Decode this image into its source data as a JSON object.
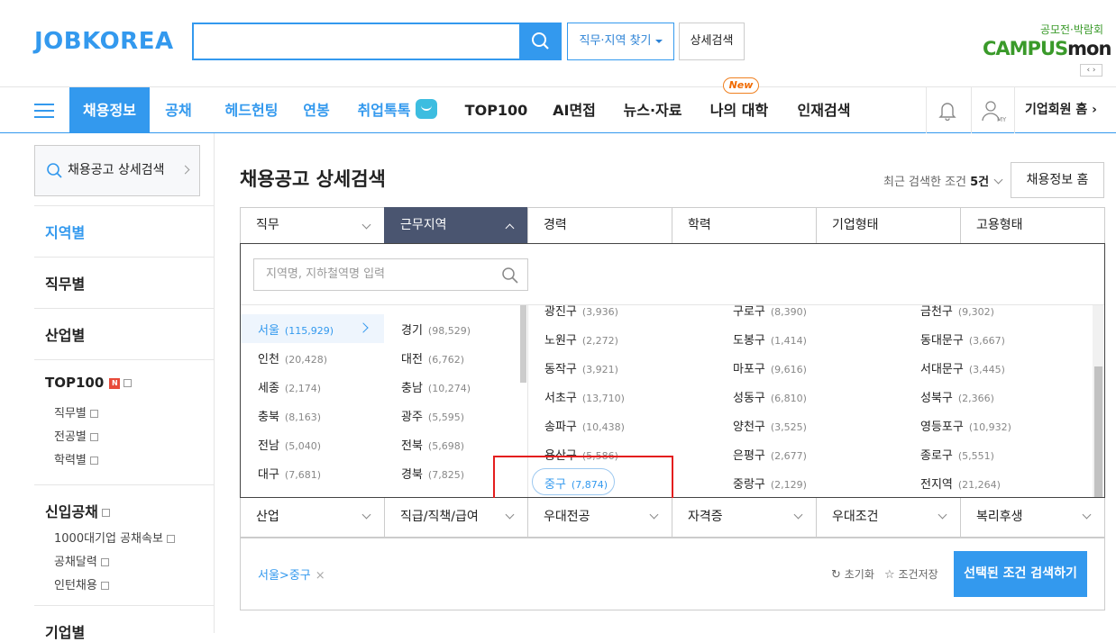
{
  "header": {
    "logo": "JOBKOREA",
    "search_value": "",
    "job_region_button": "직무·지역 찾기",
    "detail_search_button": "상세검색",
    "campus_line1": "공모전·박람회",
    "campus_line2a": "CAMPUS",
    "campus_line2b": "mon",
    "campus_nav": "‹ ›"
  },
  "nav": {
    "items": [
      "채용정보",
      "공채",
      "헤드헌팅",
      "연봉",
      "취업톡톡",
      "TOP100",
      "AI면접",
      "뉴스·자료",
      "나의 대학",
      "인재검색"
    ],
    "active": "채용정보",
    "new_badge": "New",
    "my_label": "MY",
    "corp_home": "기업회원 홈 ›"
  },
  "sidebar": {
    "search_button": "채용공고 상세검색",
    "by_region": "지역별",
    "by_job": "직무별",
    "by_industry": "산업별",
    "top100": "TOP100",
    "top100_badge": "N",
    "top100_sub": [
      "직무별",
      "전공별",
      "학력별"
    ],
    "new_recruit": "신입공채",
    "new_recruit_sub": [
      "1000대기업 공채속보",
      "공채달력",
      "인턴채용"
    ],
    "by_company": "기업별"
  },
  "main": {
    "title": "채용공고 상세검색",
    "recent_prefix": "최근 검색한 조건",
    "recent_count": "5건",
    "home_button": "채용정보 홈",
    "tabs": [
      "직무",
      "근무지역",
      "경력",
      "학력",
      "기업형태",
      "고용형태"
    ],
    "active_tab": "근무지역",
    "region_placeholder": "지역명, 지하철역명 입력",
    "regions_col1": [
      {
        "name": "서울",
        "count": "(115,929)"
      },
      {
        "name": "인천",
        "count": "(20,428)"
      },
      {
        "name": "세종",
        "count": "(2,174)"
      },
      {
        "name": "충북",
        "count": "(8,163)"
      },
      {
        "name": "전남",
        "count": "(5,040)"
      },
      {
        "name": "대구",
        "count": "(7,681)"
      }
    ],
    "regions_col2": [
      {
        "name": "경기",
        "count": "(98,529)"
      },
      {
        "name": "대전",
        "count": "(6,762)"
      },
      {
        "name": "충남",
        "count": "(10,274)"
      },
      {
        "name": "광주",
        "count": "(5,595)"
      },
      {
        "name": "전북",
        "count": "(5,698)"
      },
      {
        "name": "경북",
        "count": "(7,825)"
      }
    ],
    "districts": [
      [
        {
          "name": "광진구",
          "count": "(3,936)"
        },
        {
          "name": "구로구",
          "count": "(8,390)"
        },
        {
          "name": "금천구",
          "count": "(9,302)"
        }
      ],
      [
        {
          "name": "노원구",
          "count": "(2,272)"
        },
        {
          "name": "도봉구",
          "count": "(1,414)"
        },
        {
          "name": "동대문구",
          "count": "(3,667)"
        }
      ],
      [
        {
          "name": "동작구",
          "count": "(3,921)"
        },
        {
          "name": "마포구",
          "count": "(9,616)"
        },
        {
          "name": "서대문구",
          "count": "(3,445)"
        }
      ],
      [
        {
          "name": "서초구",
          "count": "(13,710)"
        },
        {
          "name": "성동구",
          "count": "(6,810)"
        },
        {
          "name": "성북구",
          "count": "(2,366)"
        }
      ],
      [
        {
          "name": "송파구",
          "count": "(10,438)"
        },
        {
          "name": "양천구",
          "count": "(3,525)"
        },
        {
          "name": "영등포구",
          "count": "(10,932)"
        }
      ],
      [
        {
          "name": "용산구",
          "count": "(5,586)"
        },
        {
          "name": "은평구",
          "count": "(2,677)"
        },
        {
          "name": "종로구",
          "count": "(5,551)"
        }
      ],
      [
        {
          "name": "중구",
          "count": "(7,874)"
        },
        {
          "name": "중랑구",
          "count": "(2,129)"
        },
        {
          "name": "전지역",
          "count": "(21,264)"
        }
      ]
    ],
    "tabs2": [
      "산업",
      "직급/직책/급여",
      "우대전공",
      "자격증",
      "우대조건",
      "복리후생"
    ],
    "selected_tag": "서울>중구",
    "selected_tag_remove": "×",
    "reset": "초기화",
    "save": "조건저장",
    "submit": "선택된 조건 검색하기"
  },
  "colors": {
    "brand": "#3399ee",
    "active_tab": "#4a5570",
    "highlight": "#e41e1e"
  }
}
